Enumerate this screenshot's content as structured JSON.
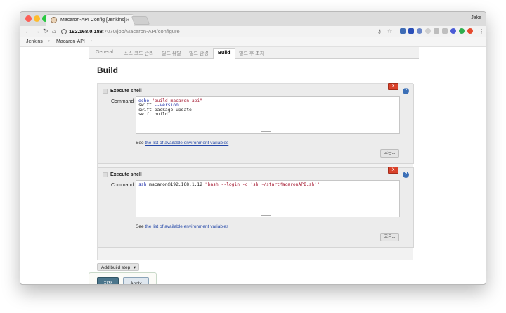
{
  "browser": {
    "tab_title": "Macaron-API Config [Jenkins]",
    "tab_close": "×",
    "profile_name": "Jake",
    "url_host": "192.168.0.188",
    "url_path": ":7070/job/Macaron-API/configure",
    "nav": {
      "back": "←",
      "forward": "→",
      "reload": "↻",
      "home": "⌂"
    },
    "toolbar_icons": {
      "key": "⚷",
      "star": "☆",
      "menu": "⋮"
    }
  },
  "breadcrumbs": [
    {
      "label": "Jenkins"
    },
    {
      "label": "Macaron-API"
    }
  ],
  "breadcrumb_sep": "›",
  "config_tabs": [
    {
      "label": "General"
    },
    {
      "label": "소스 코드 관리"
    },
    {
      "label": "빌드 유발"
    },
    {
      "label": "빌드 환경"
    },
    {
      "label": "Build",
      "active": true
    },
    {
      "label": "빌드 후 조치"
    }
  ],
  "section_title": "Build",
  "build_steps": [
    {
      "title": "Execute shell",
      "delete_label": "X",
      "help": "?",
      "command_label": "Command",
      "command": "echo \"build macaron-api\"\nswift --version\nswift package update\nswift build",
      "see_prefix": "See ",
      "see_link": "the list of available environment variables",
      "advanced_label": "고급..."
    },
    {
      "title": "Execute shell",
      "delete_label": "X",
      "help": "?",
      "command_label": "Command",
      "command": "ssh macaron@192.168.1.12 \"bash --login -c 'sh ~/startMacaronAPI.sh'\"",
      "see_prefix": "See ",
      "see_link": "the list of available environment variables",
      "advanced_label": "고급..."
    }
  ],
  "add_build_step": "Add build step",
  "add_build_step_arrow": "▾",
  "save_label": "저장",
  "apply_label": "Apply",
  "colors": {
    "delete_red": "#d9422b",
    "save_blue": "#4b758b",
    "help_blue": "#3b6fb6",
    "link_blue": "#2347a8"
  }
}
